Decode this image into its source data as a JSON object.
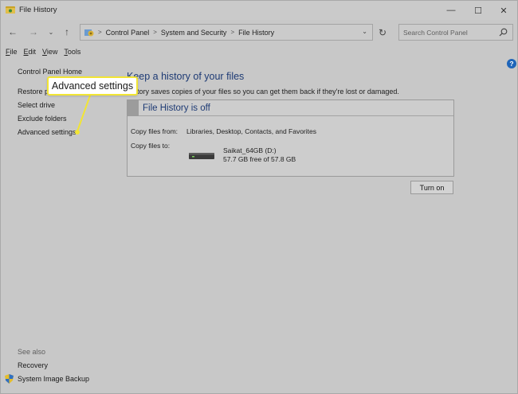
{
  "window": {
    "title": "File History",
    "controls": {
      "minimize": "—",
      "maximize": "☐",
      "close": "✕"
    }
  },
  "nav": {
    "back": "←",
    "forward": "→",
    "recent": "⌄",
    "up": "↑",
    "breadcrumb": [
      "Control Panel",
      "System and Security",
      "File History"
    ],
    "separator": ">",
    "dropdown": "⌄",
    "refresh": "↻",
    "search_placeholder": "Search Control Panel"
  },
  "menu": {
    "items": [
      {
        "acc": "F",
        "rest": "ile"
      },
      {
        "acc": "E",
        "rest": "dit"
      },
      {
        "acc": "V",
        "rest": "iew"
      },
      {
        "acc": "T",
        "rest": "ools"
      }
    ]
  },
  "help": "?",
  "left_pane": {
    "links": [
      "Control Panel Home",
      "Restore p",
      "Select drive",
      "Exclude folders",
      "Advanced settings"
    ],
    "see_also": "See also",
    "recovery": "Recovery",
    "system_image_backup": "System Image Backup"
  },
  "main": {
    "heading": "Keep a history of your files",
    "subtext": "History saves copies of your files so you can get them back if they're lost or damaged.",
    "panel": {
      "status": "File History is off",
      "copy_from_label": "Copy files from:",
      "copy_from_value": "Libraries, Desktop, Contacts, and Favorites",
      "copy_to_label": "Copy files to:",
      "drive_name": "Saikat_64GB (D:)",
      "drive_free": "57.7 GB free of 57.8 GB"
    },
    "turn_on": "Turn on"
  },
  "callout": {
    "text": "Advanced settings",
    "color": "#f2e534"
  },
  "colors": {
    "heading": "#1d3a74",
    "help": "#1f65b9"
  }
}
